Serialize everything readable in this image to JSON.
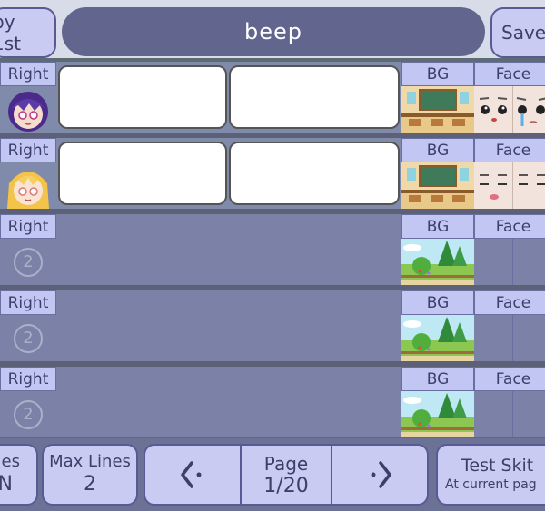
{
  "top": {
    "left_button": "py 1st",
    "title": "beep",
    "right_button": "Save"
  },
  "rows": [
    {
      "position": "Right",
      "bg_label": "BG",
      "face_label": "Face",
      "slot_number": ""
    },
    {
      "position": "Right",
      "bg_label": "BG",
      "face_label": "Face",
      "slot_number": ""
    },
    {
      "position": "Right",
      "bg_label": "BG",
      "face_label": "Face",
      "slot_number": "2"
    },
    {
      "position": "Right",
      "bg_label": "BG",
      "face_label": "Face",
      "slot_number": "2"
    },
    {
      "position": "Right",
      "bg_label": "BG",
      "face_label": "Face",
      "slot_number": "2"
    }
  ],
  "bottom": {
    "partial_button_line1": "es",
    "partial_button_line2": "N",
    "max_lines_label": "Max Lines",
    "max_lines_value": "2",
    "page_label": "Page",
    "page_value": "1/20",
    "test_label": "Test Skit",
    "test_sub": "At current pag"
  },
  "colors": {
    "button_bg": "#c9cbf3",
    "title_bg": "#62668f",
    "accent_border": "#585b93"
  },
  "icons": {
    "prev": "chevron-left-dot-icon",
    "next": "chevron-right-dot-icon"
  }
}
